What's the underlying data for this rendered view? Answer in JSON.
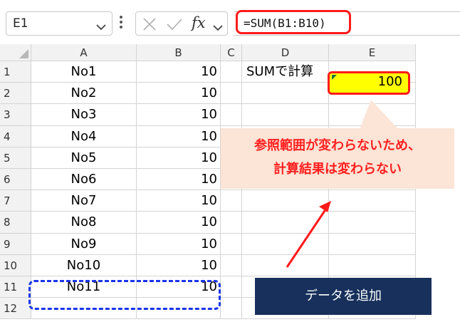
{
  "formula_bar": {
    "name_box": "E1",
    "fx_label": "fx",
    "formula": "=SUM(B1:B10)"
  },
  "columns": [
    "A",
    "B",
    "C",
    "D",
    "E"
  ],
  "rows": [
    {
      "num": "1",
      "a": "No1",
      "b": "10",
      "d": "SUMで計算",
      "e": "100"
    },
    {
      "num": "2",
      "a": "No2",
      "b": "10"
    },
    {
      "num": "3",
      "a": "No3",
      "b": "10"
    },
    {
      "num": "4",
      "a": "No4",
      "b": "10"
    },
    {
      "num": "5",
      "a": "No5",
      "b": "10"
    },
    {
      "num": "6",
      "a": "No6",
      "b": "10"
    },
    {
      "num": "7",
      "a": "No7",
      "b": "10"
    },
    {
      "num": "8",
      "a": "No8",
      "b": "10"
    },
    {
      "num": "9",
      "a": "No9",
      "b": "10"
    },
    {
      "num": "10",
      "a": "No10",
      "b": "10"
    },
    {
      "num": "11",
      "a": "No11",
      "b": "10"
    },
    {
      "num": "12"
    }
  ],
  "callout": {
    "line1": "参照範囲が変わらないため、",
    "line2": "計算結果は変わらない"
  },
  "note": "データを追加",
  "colors": {
    "highlight_red": "#ff1a1a",
    "selection_blue": "#1a35e8",
    "cell_yellow": "#ffff00",
    "callout_bg": "#fce4d6",
    "note_bg": "#17305c"
  }
}
